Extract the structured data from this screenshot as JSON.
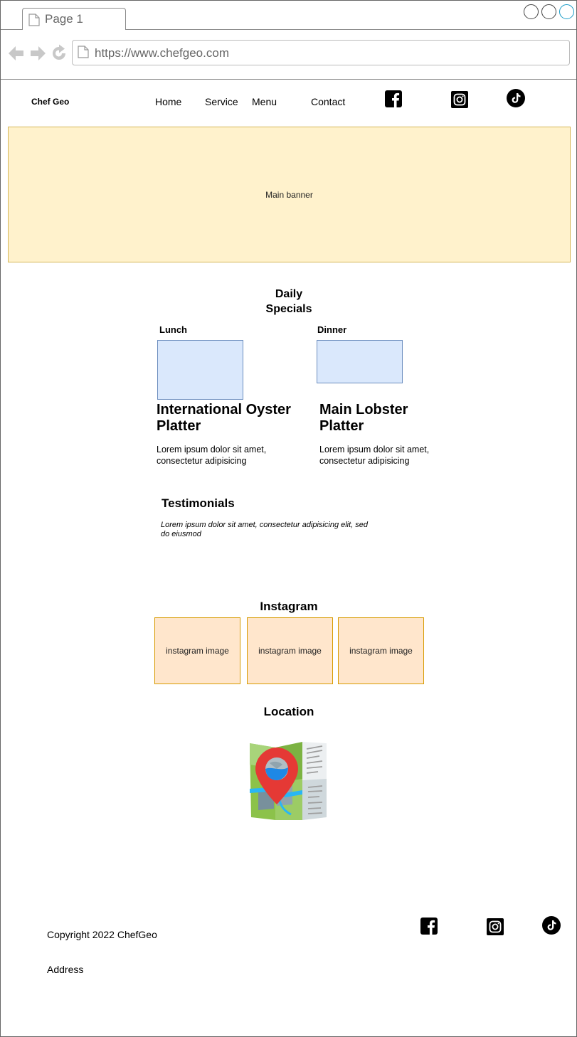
{
  "browser": {
    "tab_label": "Page 1",
    "url": "https://www.chefgeo.com"
  },
  "header": {
    "brand": "Chef Geo",
    "nav": [
      "Home",
      "Service",
      "Menu",
      "Contact"
    ],
    "social_icons": [
      "facebook-icon",
      "instagram-icon",
      "tiktok-icon"
    ]
  },
  "banner": {
    "label": "Main banner"
  },
  "specials": {
    "title_line1": "Daily",
    "title_line2": "Specials",
    "lunch": {
      "label": "Lunch",
      "title_line1": "International Oyster",
      "title_line2": "Platter",
      "desc_line1": "Lorem ipsum dolor sit amet,",
      "desc_line2": "consectetur adipisicing"
    },
    "dinner": {
      "label": "Dinner",
      "title_line1": "Main Lobster",
      "title_line2": "Platter",
      "desc_line1": "Lorem ipsum dolor sit amet,",
      "desc_line2": "consectetur adipisicing"
    }
  },
  "testimonials": {
    "title": "Testimonials",
    "text_line1": "Lorem ipsum dolor sit amet, consectetur adipisicing elit, sed",
    "text_line2": "do eiusmod"
  },
  "instagram": {
    "title": "Instagram",
    "images": [
      "instagram image",
      "instagram image",
      "instagram image"
    ]
  },
  "location": {
    "title": "Location",
    "icon": "map-pin-icon"
  },
  "footer": {
    "copyright": "Copyright 2022 ChefGeo",
    "address": "Address",
    "social_icons": [
      "facebook-icon",
      "instagram-icon",
      "tiktok-icon"
    ]
  },
  "colors": {
    "banner_fill": "#fff2cc",
    "banner_border": "#d6b656",
    "meal_fill": "#dae8fc",
    "meal_border": "#6c8ebf",
    "insta_fill": "#ffe6cc",
    "insta_border": "#d79b00"
  }
}
